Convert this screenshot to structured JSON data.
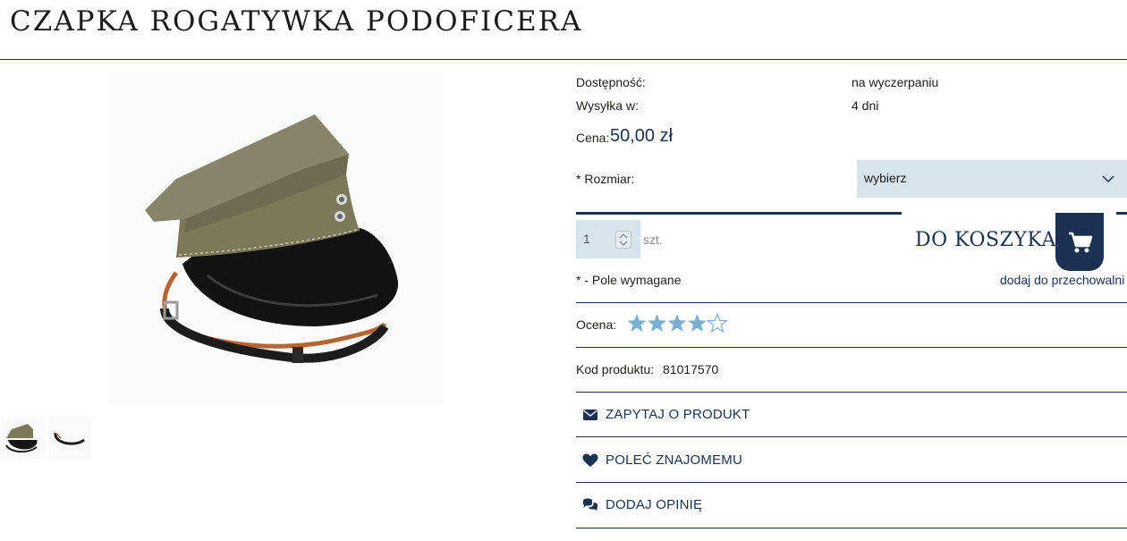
{
  "product": {
    "title": "CZAPKA ROGATYWKA PODOFICERA",
    "availability_label": "Dostępność:",
    "availability_value": "na wyczerpaniu",
    "shipping_label": "Wysyłka w:",
    "shipping_value": "4 dni",
    "price_label": "Cena:",
    "price_value": "50,00 zł",
    "size_label": "* Rozmiar:",
    "size_selected": "wybierz",
    "quantity_value": "1",
    "quantity_unit": "szt.",
    "add_to_cart_label": "DO KOSZYKA",
    "required_note": "* - Pole wymagane",
    "storage_link": "dodaj do przechowalni",
    "rating_label": "Ocena:",
    "rating_value": 4,
    "rating_max": 5,
    "code_label": "Kod produktu:",
    "code_value": "81017570"
  },
  "actions": [
    {
      "label": "ZAPYTAJ O PRODUKT",
      "icon": "envelope-icon"
    },
    {
      "label": "POLEĆ ZNAJOMEMU",
      "icon": "heart-icon"
    },
    {
      "label": "DODAJ OPINIĘ",
      "icon": "comments-icon"
    }
  ],
  "colors": {
    "accent": "#1a3152",
    "field_bg": "#d8e4ec",
    "star_fill": "#7aaed2"
  }
}
